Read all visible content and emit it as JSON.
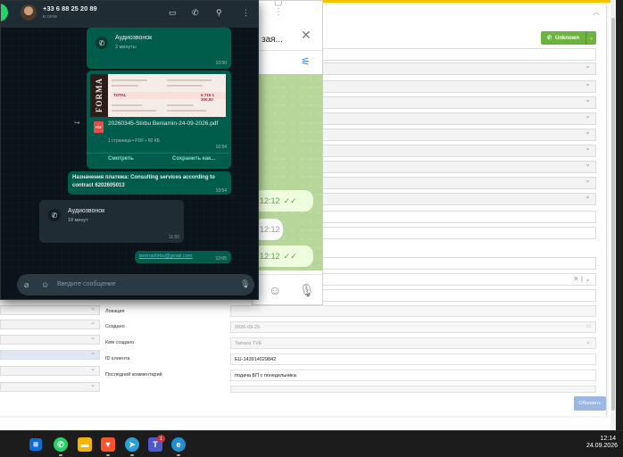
{
  "crm": {
    "unknown_label": "Unknown",
    "fields": [
      {
        "label": "Локация",
        "value": ""
      },
      {
        "label": "Создано",
        "value": "2026-09-25"
      },
      {
        "label": "Кем создано",
        "value": "Tamara TVE"
      },
      {
        "label": "ID клиента",
        "value": "EU-143914029842"
      },
      {
        "label": "Последний комментарий",
        "value": "подача БП с понедельника"
      }
    ],
    "update_button": "Обновить",
    "colors": {
      "accent_green": "#6cb33f",
      "top_bar": "#f5c400",
      "update_button": "#9ab7e6"
    }
  },
  "telegram": {
    "title": "зая...",
    "messages": [
      {
        "time": "12:12",
        "direction": "out"
      },
      {
        "time": "12:12",
        "direction": "in"
      },
      {
        "time": "12:12",
        "direction": "out"
      }
    ]
  },
  "whatsapp": {
    "contact_name": "+33 6 88 25 20 89",
    "contact_status": "в сети",
    "call1": {
      "title": "Аудиозвонок",
      "duration": "2 минуты",
      "time": "10:50"
    },
    "pdf": {
      "preview_side_text": "FORMA",
      "preview_total_label": "TOTAL",
      "preview_total_amount": "5 715 1 300,00",
      "file_name": "20260345-Stirbu Beniamin-24-09-2026.pdf",
      "meta": "1 страница • PDF • 60 КБ",
      "time": "10:54",
      "open_label": "Смотреть",
      "save_label": "Сохранить как..."
    },
    "payment": {
      "prefix": "Назначения платежа:",
      "text": "Consulting services according to contract 6202605013",
      "time": "10:54"
    },
    "call2": {
      "title": "Аудиозвонок",
      "duration": "18 минут",
      "time": "11:55"
    },
    "email": {
      "text": "beenastirbu@gmail.com",
      "time": "12:05"
    },
    "input_placeholder": "Введите сообщение",
    "colors": {
      "header": "#1f2c33",
      "outgoing": "#005c4b",
      "incoming": "#202c33"
    }
  },
  "taskbar": {
    "time": "12:14",
    "date": "24.09.2026",
    "badge": "1",
    "apps": [
      "windows-start",
      "whatsapp",
      "file-explorer",
      "brave",
      "telegram",
      "teams",
      "edge"
    ]
  }
}
